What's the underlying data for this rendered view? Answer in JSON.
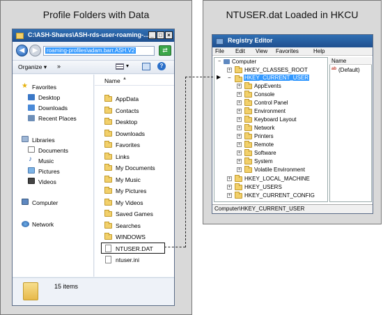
{
  "left_panel": {
    "title": "Profile Folders with Data",
    "explorer": {
      "window_title": "C:\\ASH-Shares\\ASH-rds-user-roaming-...",
      "address": "roaming-profiles\\adam.barr.ASH.V2",
      "toolbar": {
        "organize": "Organize",
        "more": "»"
      },
      "nav": {
        "favorites": "Favorites",
        "desktop": "Desktop",
        "downloads": "Downloads",
        "recent_places": "Recent Places",
        "libraries": "Libraries",
        "documents": "Documents",
        "music": "Music",
        "pictures": "Pictures",
        "videos": "Videos",
        "computer": "Computer",
        "network": "Network"
      },
      "column_header": "Name",
      "files": [
        "AppData",
        "Contacts",
        "Desktop",
        "Downloads",
        "Favorites",
        "Links",
        "My Documents",
        "My Music",
        "My Pictures",
        "My Videos",
        "Saved Games",
        "Searches",
        "WINDOWS",
        "NTUSER.DAT",
        "ntuser.ini"
      ],
      "status": "15 items"
    }
  },
  "right_panel": {
    "title": "NTUSER.dat Loaded in HKCU",
    "regedit": {
      "window_title": "Registry Editor",
      "menu": [
        "File",
        "Edit",
        "View",
        "Favorites",
        "Help"
      ],
      "tree": {
        "root": "Computer",
        "hkcr": "HKEY_CLASSES_ROOT",
        "hkcu": "HKEY_CURRENT_USER",
        "children": [
          "AppEvents",
          "Console",
          "Control Panel",
          "Environment",
          "Keyboard Layout",
          "Network",
          "Printers",
          "Remote",
          "Software",
          "System",
          "Volatile Environment"
        ],
        "hklm": "HKEY_LOCAL_MACHINE",
        "hku": "HKEY_USERS",
        "hkcc": "HKEY_CURRENT_CONFIG"
      },
      "value_header": "Name",
      "value_default": "(Default)",
      "statusbar": "Computer\\HKEY_CURRENT_USER"
    }
  },
  "colors": {
    "titlebar": "#2f6fb3",
    "selection": "#3399ff",
    "folder": "#f2d06b"
  }
}
